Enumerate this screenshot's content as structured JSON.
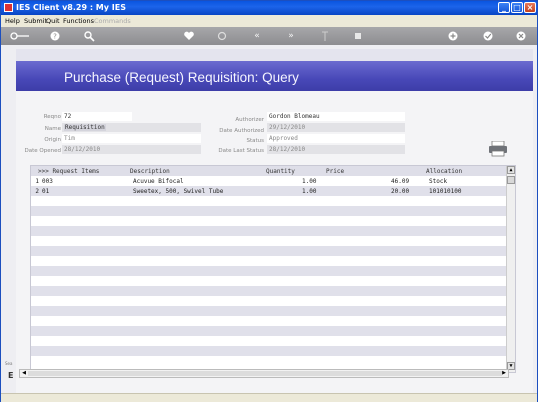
{
  "window": {
    "title": "IES Client v8.29 : My IES"
  },
  "window_buttons": {
    "minimize": "_",
    "maximize": "□",
    "close": "×"
  },
  "menu": {
    "help": "Help",
    "submit": "Submit",
    "quit": "Quit",
    "functions": "Functions",
    "commands": "Commands"
  },
  "toolbar_icons": [
    "key-icon",
    "help-icon",
    "search-icon",
    "heart-icon",
    "refresh-icon",
    "rewind-icon",
    "fast-forward-icon",
    "upload-icon",
    "stop-icon",
    "add-icon",
    "check-icon",
    "close-icon"
  ],
  "page": {
    "title": "Purchase (Request) Requisition: Query"
  },
  "form": {
    "reqno_label": "Reqno",
    "reqno": "72",
    "name_label": "Name",
    "name": "Requisition",
    "origin_label": "Origin",
    "origin": "Tim",
    "date_opened_label": "Date Opened",
    "date_opened": "28/12/2010",
    "authorizer_label": "Authorizer",
    "authorizer": "Gordon Blomeau",
    "date_authorized_label": "Date Authorized",
    "date_authorized": "29/12/2010",
    "status_label": "Status",
    "status": "Approved",
    "date_last_status_label": "Date Last Status",
    "date_last_status": "28/12/2010"
  },
  "grid": {
    "headers": {
      "items": ">>> Request Items",
      "description": "Description",
      "quantity": "Quantity",
      "price": "Price",
      "allocation": "Allocation"
    },
    "rows": [
      {
        "num": "1",
        "item": "003",
        "description": "Acuvue Bifocal",
        "quantity": "1.00",
        "price": "46.09",
        "allocation": "Stock"
      },
      {
        "num": "2",
        "item": "01",
        "description": "Sweetex, 500, Swivel Tube",
        "quantity": "1.00",
        "price": "20.00",
        "allocation": "101010100"
      }
    ]
  },
  "side": {
    "stub": "Sea",
    "e": "E"
  }
}
